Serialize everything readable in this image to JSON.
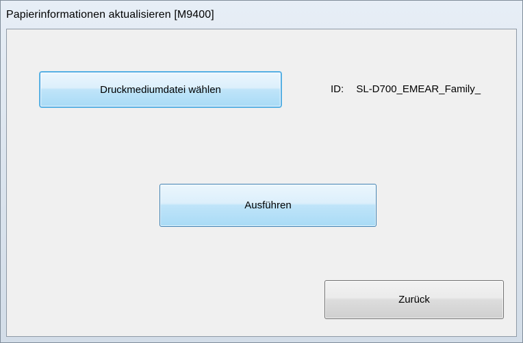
{
  "window": {
    "title": "Papierinformationen aktualisieren [M9400]"
  },
  "buttons": {
    "select_media_label": "Druckmediumdatei wählen",
    "execute_label": "Ausführen",
    "back_label": "Zurück"
  },
  "id_info": {
    "label": "ID:",
    "value": "SL-D700_EMEAR_Family_"
  }
}
